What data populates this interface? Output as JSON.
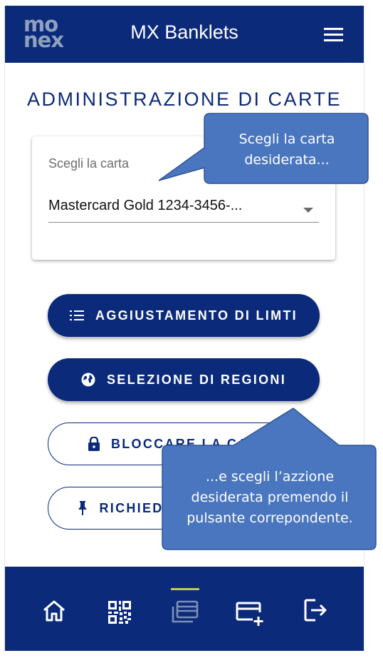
{
  "header": {
    "logo_line1": "mo",
    "logo_line2": "nex",
    "title": "MX Banklets",
    "menu_icon": "hamburger-menu-icon"
  },
  "main": {
    "heading": "ADMINISTRAZIONE DI CARTE",
    "card_selector": {
      "label": "Scegli la carta",
      "selected_value": "Mastercard Gold 1234-3456-..."
    },
    "actions": [
      {
        "label": "AGGIUSTAMENTO DI LIMTI",
        "icon": "list-icon",
        "style": "filled"
      },
      {
        "label": "SELEZIONE DI REGIONI",
        "icon": "globe-icon",
        "style": "filled"
      },
      {
        "label": "BLOCCARE LA CARTA",
        "icon": "lock-icon",
        "style": "outlined"
      },
      {
        "label": "RICHIEDERE UNA CARTA",
        "icon": "pin-icon",
        "style": "outlined"
      }
    ]
  },
  "bottom_nav": [
    {
      "name": "home",
      "icon": "home-icon",
      "active": false
    },
    {
      "name": "qr",
      "icon": "qr-code-icon",
      "active": false
    },
    {
      "name": "cards",
      "icon": "cards-icon",
      "active": true
    },
    {
      "name": "add-card",
      "icon": "add-card-icon",
      "active": false
    },
    {
      "name": "logout",
      "icon": "logout-icon",
      "active": false
    }
  ],
  "callouts": {
    "top": "Scegli la carta desiderata...",
    "bottom": "...e scegli l’azzione desiderata premendo il pulsante correpondente."
  },
  "colors": {
    "primary": "#0b2a7a",
    "callout_fill": "#4a76bf",
    "callout_border": "#2f5496",
    "active_indicator": "#b9d04a",
    "logo": "#8fa0bf"
  }
}
